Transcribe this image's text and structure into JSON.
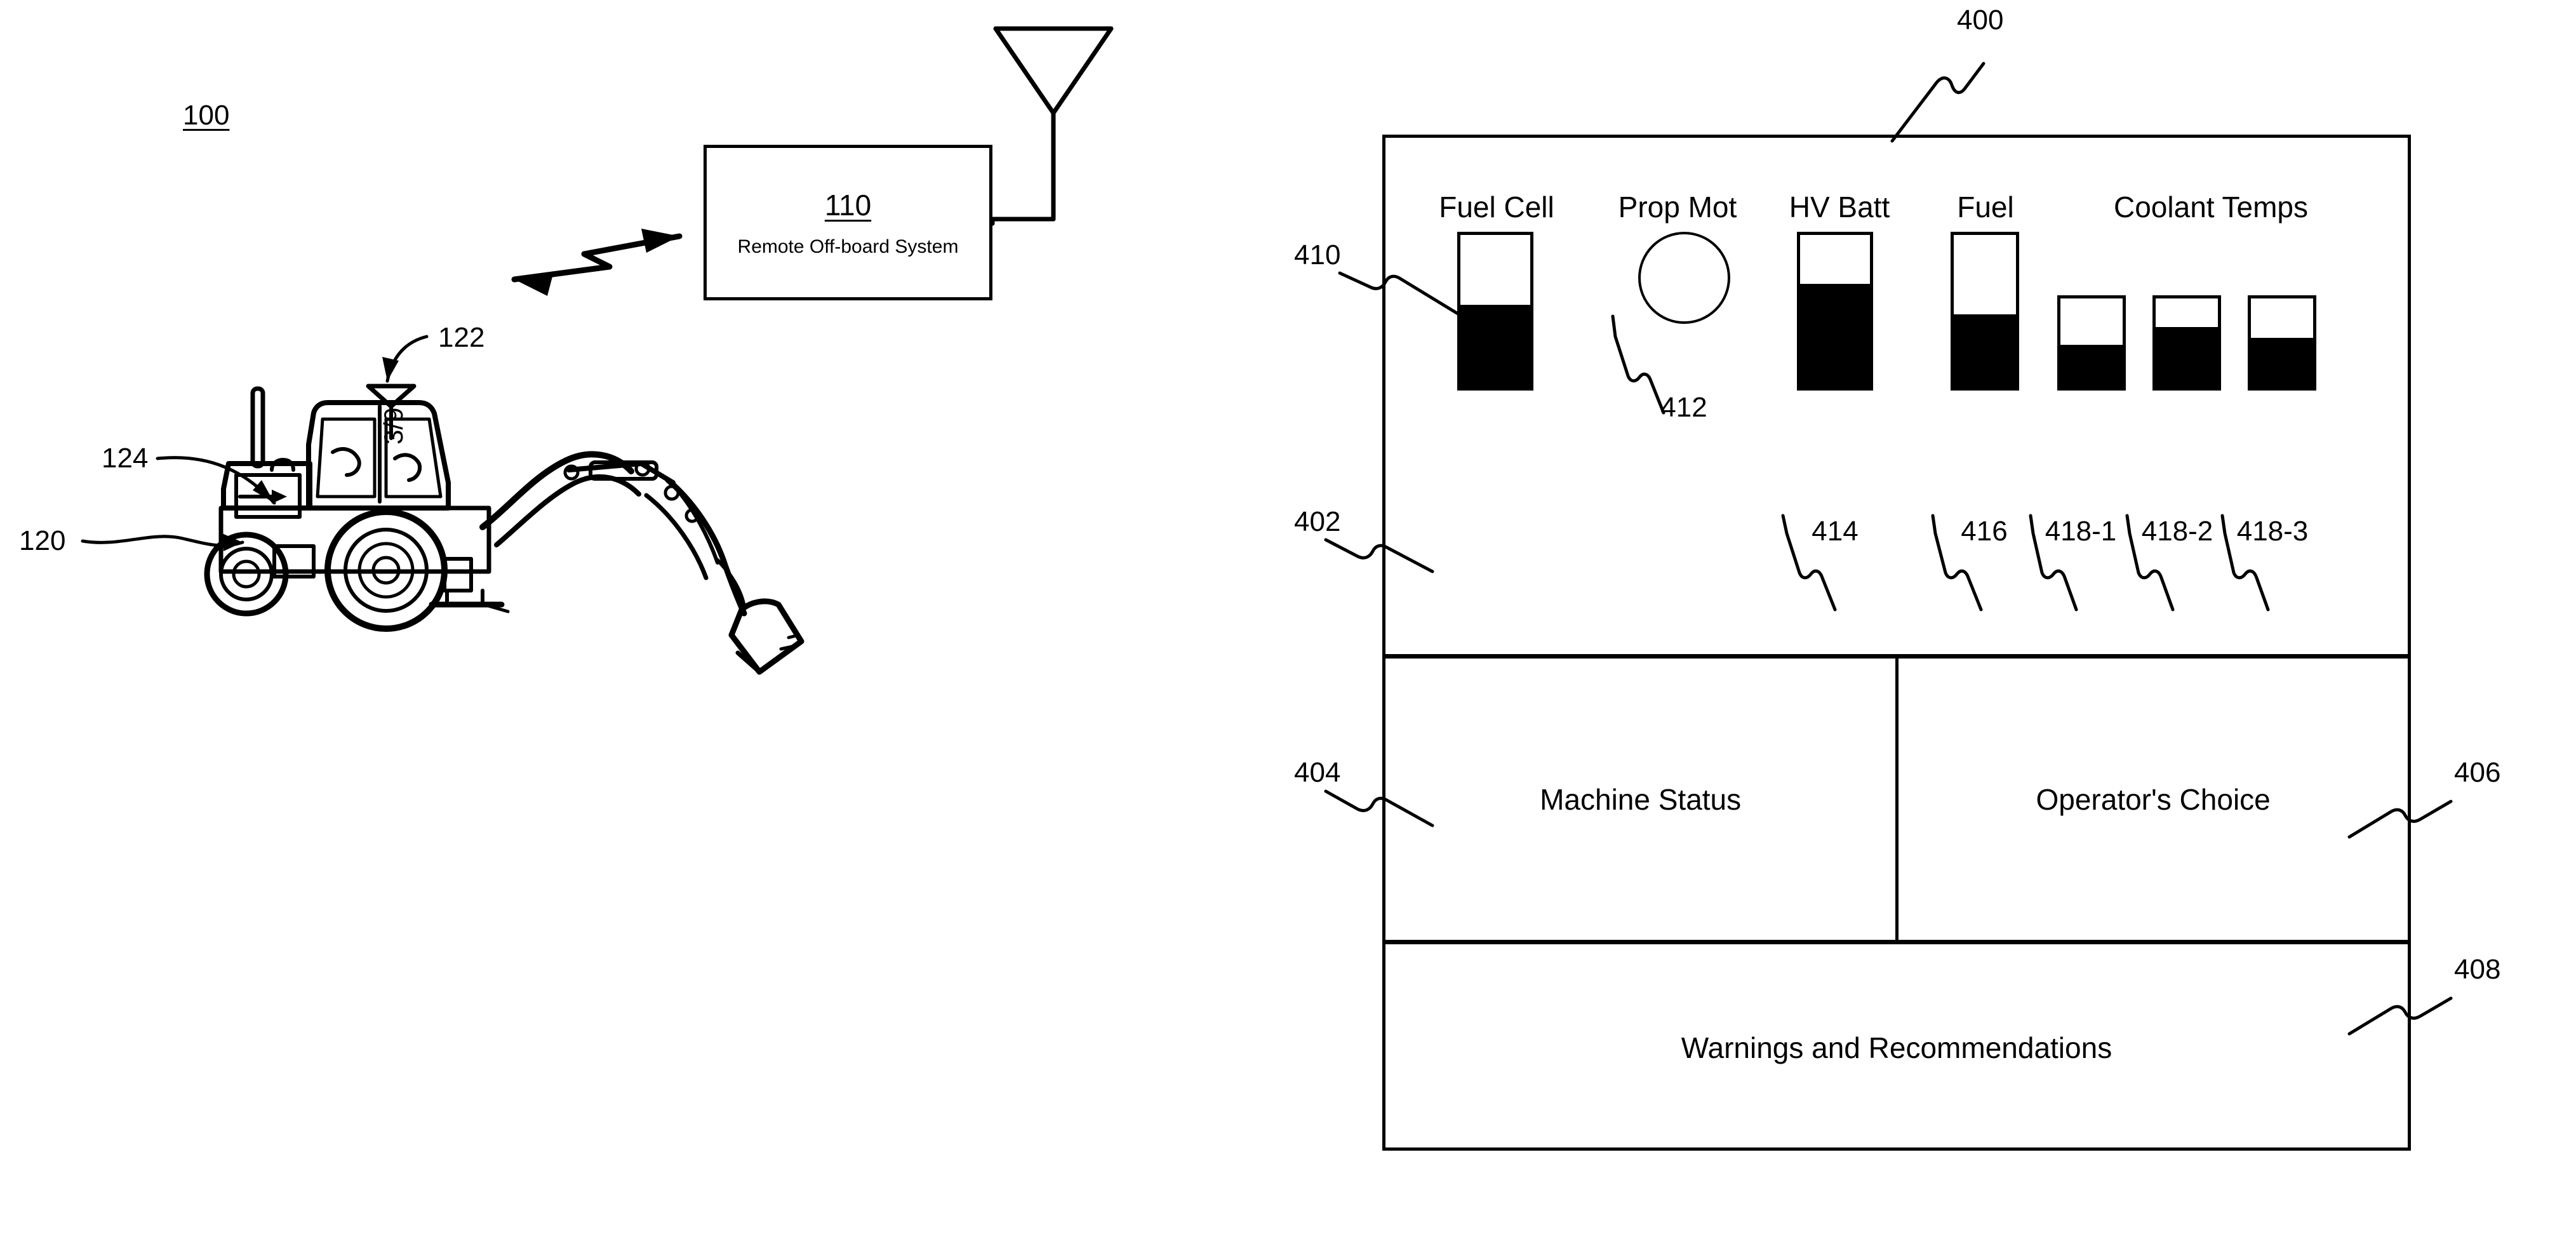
{
  "figure": {
    "sheet_marker": "3/9"
  },
  "left_diagram": {
    "system_ref": "100",
    "offboard": {
      "ref": "110",
      "label": "Remote Off-board System"
    },
    "machine_ref": "120",
    "antenna_ref": "122",
    "cab_ref": "124"
  },
  "display": {
    "ref": "400",
    "gauge_region_ref": "402",
    "status_region_ref": "404",
    "choice_region_ref": "406",
    "warnings_region_ref": "408",
    "gauge_group_ref": "410",
    "panels": {
      "machine_status": "Machine Status",
      "operators_choice": "Operator's Choice",
      "warnings": "Warnings and Recommendations"
    },
    "group_titles": {
      "coolant_temps": "Coolant Temps"
    },
    "gauges": [
      {
        "ref": "410",
        "label": "Fuel Cell",
        "fill_percent": 54,
        "type": "bar"
      },
      {
        "ref": "412",
        "label": "Prop Mot",
        "fill_percent": 0,
        "type": "circle"
      },
      {
        "ref": "414",
        "label": "HV Batt",
        "fill_percent": 68,
        "type": "bar"
      },
      {
        "ref": "416",
        "label": "Fuel",
        "fill_percent": 48,
        "type": "bar"
      },
      {
        "ref": "418-1",
        "label": "",
        "fill_percent": 48,
        "type": "bar"
      },
      {
        "ref": "418-2",
        "label": "",
        "fill_percent": 68,
        "type": "bar"
      },
      {
        "ref": "418-3",
        "label": "",
        "fill_percent": 56,
        "type": "bar"
      }
    ]
  },
  "colors": {
    "ink": "#000000",
    "paper": "#ffffff"
  }
}
